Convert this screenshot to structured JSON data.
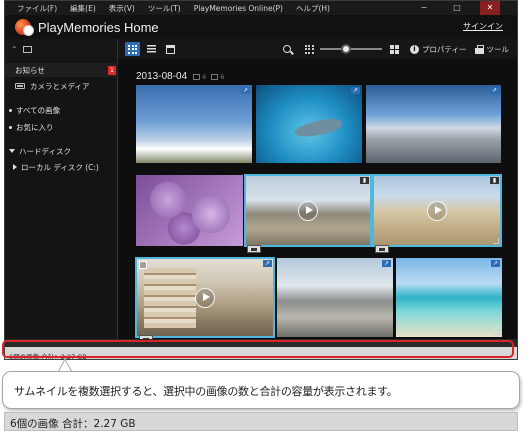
{
  "menu": {
    "file": "ファイル(F)",
    "edit": "編集(E)",
    "view": "表示(V)",
    "tools": "ツール(T)",
    "online": "PlayMemories Online(P)",
    "help": "ヘルプ(H)"
  },
  "app": {
    "title": "PlayMemories Home",
    "signin": "サインイン"
  },
  "toolbar": {
    "properties_label": "プロパティー",
    "tools_label": "ツール",
    "thumbnail_size_level": 0.4
  },
  "sidebar": {
    "items": [
      {
        "label": "お知らせ",
        "badge": "1"
      },
      {
        "label": "カメラとメディア"
      },
      {
        "label": "すべての画像"
      },
      {
        "label": "お気に入り"
      },
      {
        "label": "ハードディスク"
      },
      {
        "label": "ローカル ディスク (C:)"
      }
    ]
  },
  "content": {
    "date": "2013-08-04",
    "photo_count": "6",
    "video_count": "6",
    "thumbnails": [
      {
        "kind": "photo",
        "scene": "sky-clouds",
        "selected": false
      },
      {
        "kind": "photo",
        "scene": "underwater-whale",
        "selected": false
      },
      {
        "kind": "photo",
        "scene": "beach-fisheye",
        "selected": false
      },
      {
        "kind": "photo",
        "scene": "purple-roses",
        "selected": false
      },
      {
        "kind": "video",
        "scene": "harbor-walk",
        "selected": true
      },
      {
        "kind": "video",
        "scene": "sandy-beach",
        "selected": true
      },
      {
        "kind": "video",
        "scene": "books-stack",
        "selected": true
      },
      {
        "kind": "photo",
        "scene": "road-coast",
        "selected": false
      },
      {
        "kind": "photo",
        "scene": "tropical-sea",
        "selected": false
      }
    ]
  },
  "status": {
    "selection_text": "6個の画像 合計：2.27 GB"
  },
  "callout": {
    "text": "サムネイルを複数選択すると、選択中の画像の数と合計の容量が表示されます。",
    "zoom_text": "6個の画像 合計：2.27 GB"
  },
  "colors": {
    "accent": "#2e6db4",
    "selection": "#4fb6dd",
    "highlight_ring": "#d9242a",
    "badge": "#e02a2a"
  }
}
